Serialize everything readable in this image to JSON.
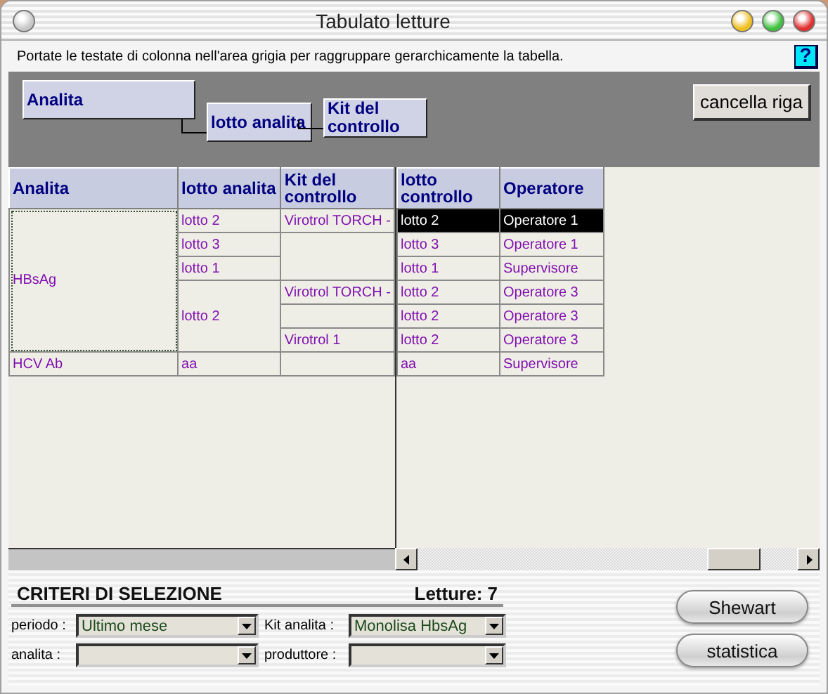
{
  "window": {
    "title": "Tabulato letture"
  },
  "hint": "Portate le testate di colonna nell'area grigia per raggruppare gerarchicamente la tabella.",
  "help_button": "?",
  "group_by": [
    {
      "label": "Analita"
    },
    {
      "label": "lotto analita"
    },
    {
      "label": "Kit del controllo"
    }
  ],
  "delete_row_button": "cancella riga",
  "table": {
    "group_columns": [
      "Analita",
      "lotto analita",
      "Kit del controllo"
    ],
    "detail_columns": [
      "lotto controllo",
      "Operatore"
    ],
    "groups": [
      {
        "analita": "HBsAg",
        "focused": true,
        "lotti": [
          {
            "lotto": "lotto 2",
            "kits": [
              {
                "kit": "Virotrol TORCH -",
                "readings": [
                  {
                    "lotto_controllo": "lotto 2",
                    "operatore": "Operatore 1",
                    "selected": true
                  }
                ]
              }
            ]
          },
          {
            "lotto": "lotto 3",
            "kits": [
              {
                "readings": [
                  {
                    "lotto_controllo": "lotto 3",
                    "operatore": "Operatore 1",
                    "selected": false
                  }
                ]
              }
            ]
          },
          {
            "lotto": "lotto 1",
            "kits": [
              {
                "readings": [
                  {
                    "lotto_controllo": "lotto 1",
                    "operatore": "Supervisore",
                    "selected": false
                  }
                ]
              }
            ]
          },
          {
            "lotto": "lotto 2",
            "kits": [
              {
                "kit": "Virotrol TORCH -",
                "readings": [
                  {
                    "lotto_controllo": "lotto 2",
                    "operatore": "Operatore 3",
                    "selected": false
                  }
                ]
              },
              {
                "readings": [
                  {
                    "lotto_controllo": "lotto 2",
                    "operatore": "Operatore 3",
                    "selected": false
                  }
                ]
              },
              {
                "kit": "Virotrol 1",
                "readings": [
                  {
                    "lotto_controllo": "lotto 2",
                    "operatore": "Operatore 3",
                    "selected": false
                  }
                ]
              }
            ]
          }
        ]
      },
      {
        "analita": "HCV Ab",
        "focused": false,
        "lotti": [
          {
            "lotto": "aa",
            "kits": [
              {
                "readings": [
                  {
                    "lotto_controllo": "aa",
                    "operatore": "Supervisore",
                    "selected": false
                  }
                ]
              }
            ]
          }
        ]
      }
    ]
  },
  "criteria": {
    "title": "CRITERI DI SELEZIONE",
    "count": "Letture: 7",
    "fields": [
      {
        "label": "periodo :",
        "value": "Ultimo mese"
      },
      {
        "label": "Kit analita :",
        "value": "Monolisa HbsAg"
      },
      {
        "label": "analita :"
      },
      {
        "label": "produttore :"
      }
    ]
  },
  "buttons": [
    "Shewart",
    "statistica"
  ]
}
